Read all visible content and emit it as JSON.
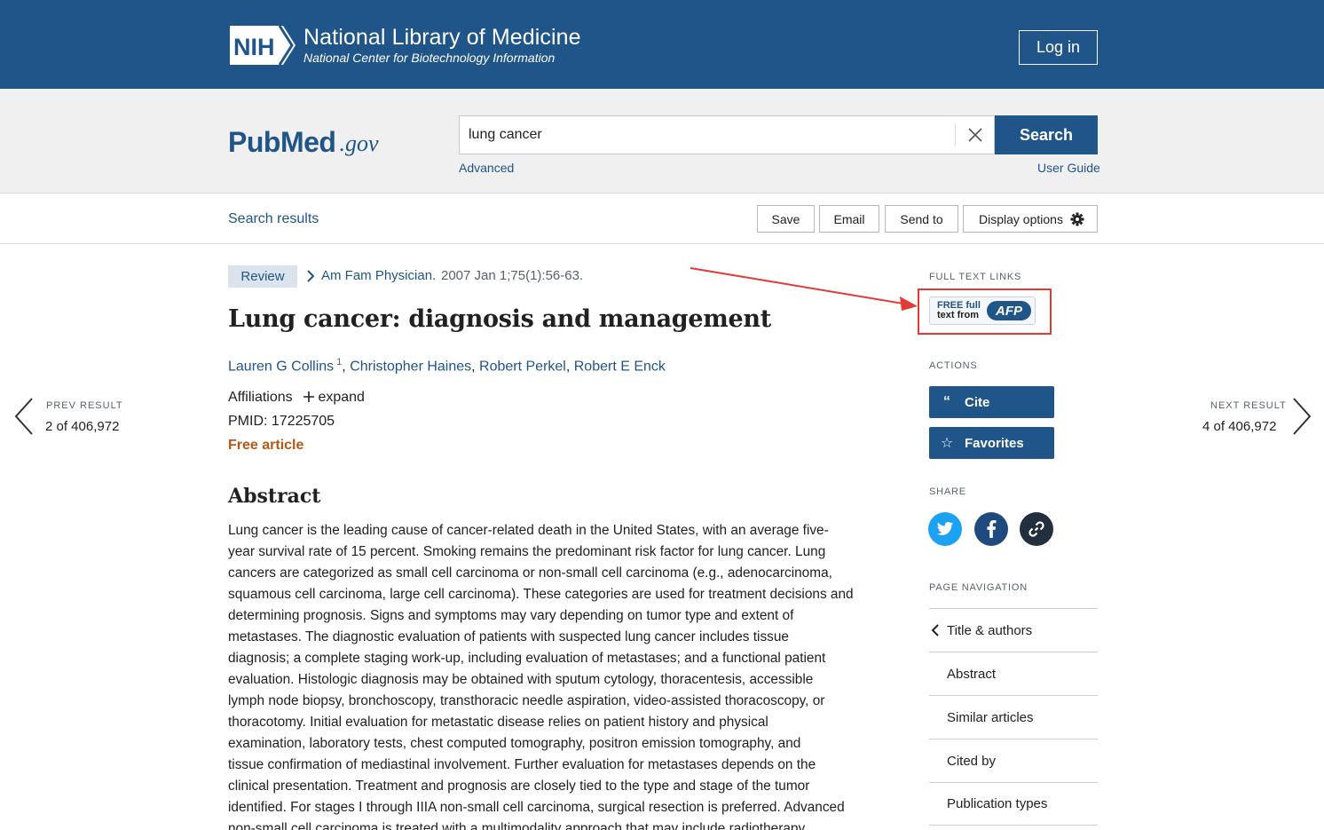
{
  "nih": {
    "title": "National Library of Medicine",
    "subtitle": "National Center for Biotechnology Information",
    "logo_text": "NIH",
    "login_label": "Log in"
  },
  "pubmed": {
    "logo_main": "PubMed",
    "logo_suffix": ".gov"
  },
  "search": {
    "value": "lung cancer",
    "button_label": "Search",
    "advanced_label": "Advanced",
    "user_guide_label": "User Guide"
  },
  "toolbar": {
    "back_label": "Search results",
    "save_label": "Save",
    "email_label": "Email",
    "send_to_label": "Send to",
    "display_options_label": "Display options"
  },
  "article": {
    "type_badge": "Review",
    "journal": "Am Fam Physician.",
    "citation_date": "2007 Jan 1;75(1):56-63.",
    "title": "Lung cancer: diagnosis and management",
    "authors": [
      {
        "name": "Lauren G Collins",
        "sup": "1"
      },
      {
        "name": "Christopher Haines"
      },
      {
        "name": "Robert Perkel"
      },
      {
        "name": "Robert E Enck"
      }
    ],
    "affiliations_label": "Affiliations",
    "expand_label": "expand",
    "pmid": "PMID: 17225705",
    "free_label": "Free article",
    "abstract_heading": "Abstract",
    "abstract_lines": [
      "Lung cancer is the leading cause of cancer-related death in the United States, with an average five-",
      "year survival rate of 15 percent. Smoking remains the predominant risk factor for lung cancer. Lung",
      "cancers are categorized as small cell carcinoma or non-small cell carcinoma (e.g., adenocarcinoma,",
      "squamous cell carcinoma, large cell carcinoma). These categories are used for treatment decisions and",
      "determining prognosis. Signs and symptoms may vary depending on tumor type and extent of",
      "metastases. The diagnostic evaluation of patients with suspected lung cancer includes tissue",
      "diagnosis; a complete staging work-up, including evaluation of metastases; and a functional patient",
      "evaluation. Histologic diagnosis may be obtained with sputum cytology, thoracentesis, accessible",
      "lymph node biopsy, bronchoscopy, transthoracic needle aspiration, video-assisted thoracoscopy, or",
      "thoracotomy. Initial evaluation for metastatic disease relies on patient history and physical",
      "examination, laboratory tests, chest computed tomography, positron emission tomography, and",
      "tissue confirmation of mediastinal involvement. Further evaluation for metastases depends on the",
      "clinical presentation. Treatment and prognosis are closely tied to the type and stage of the tumor",
      "identified. For stages I through IIIA non-small cell carcinoma, surgical resection is preferred. Advanced",
      "non-small cell carcinoma is treated with a multimodality approach that may include radiotherapy,"
    ]
  },
  "pager": {
    "prev_label": "PREV RESULT",
    "prev_count": "2 of 406,972",
    "next_label": "NEXT RESULT",
    "next_count": "4 of 406,972"
  },
  "rail": {
    "full_text_heading": "FULL TEXT LINKS",
    "afp_free": "FREE full",
    "afp_text_from": "text from",
    "afp_brand": "AFP",
    "actions_heading": "ACTIONS",
    "cite_label": "Cite",
    "favorites_label": "Favorites",
    "share_heading": "SHARE",
    "page_nav_heading": "PAGE NAVIGATION",
    "page_nav_items": [
      "Title & authors",
      "Abstract",
      "Similar articles",
      "Cited by",
      "Publication types"
    ]
  },
  "colors": {
    "brand": "#20558a",
    "free_article": "#b35a16",
    "twitter": "#1da1f2",
    "facebook": "#1f4a7d",
    "link_share": "#212f3f",
    "highlight": "#e53935"
  }
}
